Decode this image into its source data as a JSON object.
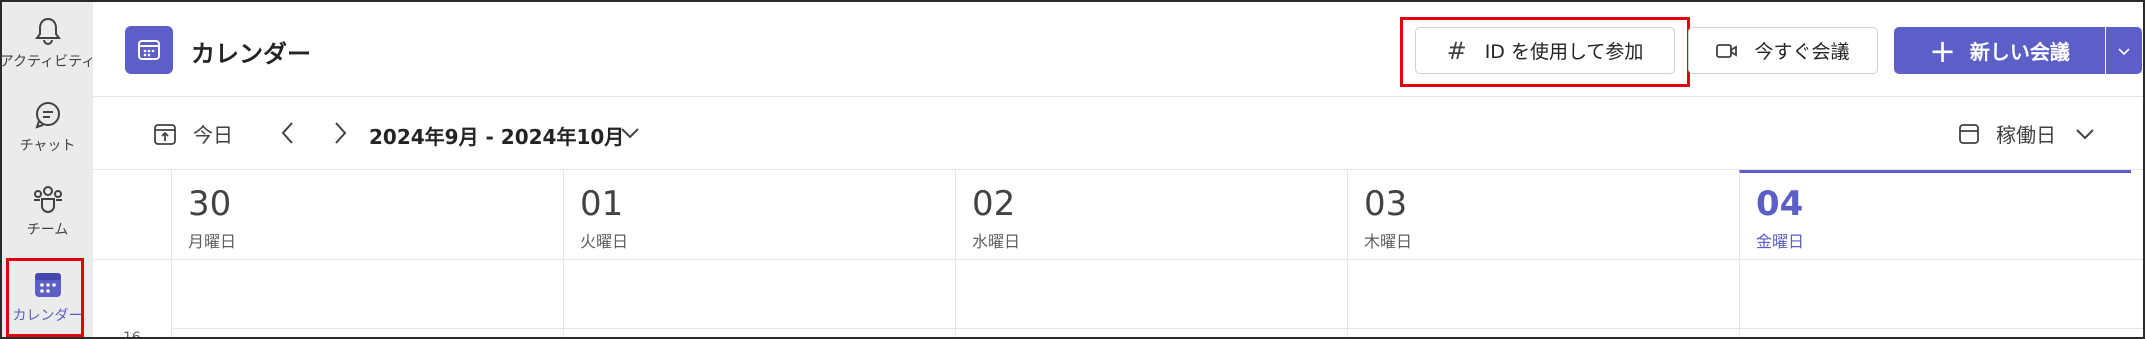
{
  "rail": {
    "items": [
      {
        "label": "アクティビティ",
        "icon": "bell-icon"
      },
      {
        "label": "チャット",
        "icon": "chat-icon"
      },
      {
        "label": "チーム",
        "icon": "teams-icon"
      },
      {
        "label": "カレンダー",
        "icon": "calendar-icon",
        "active": true
      }
    ]
  },
  "header": {
    "title": "カレンダー",
    "join_button": {
      "icon": "#",
      "label": "ID を使用して参加"
    },
    "meet_now_label": "今すぐ会議",
    "new_meeting": {
      "icon": "+",
      "label": "新しい会議"
    }
  },
  "toolbar": {
    "today_label": "今日",
    "date_range": "2024年9月 - 2024年10月",
    "view_label": "稼働日"
  },
  "days": [
    {
      "num": "30",
      "name": "月曜日"
    },
    {
      "num": "01",
      "name": "火曜日"
    },
    {
      "num": "02",
      "name": "水曜日"
    },
    {
      "num": "03",
      "name": "木曜日"
    },
    {
      "num": "04",
      "name": "金曜日",
      "today": true
    }
  ],
  "grid": {
    "first_hour": "16"
  },
  "colors": {
    "accent": "#5b5fc7",
    "highlight": "#e3000f",
    "rail_bg": "#ebebeb"
  }
}
